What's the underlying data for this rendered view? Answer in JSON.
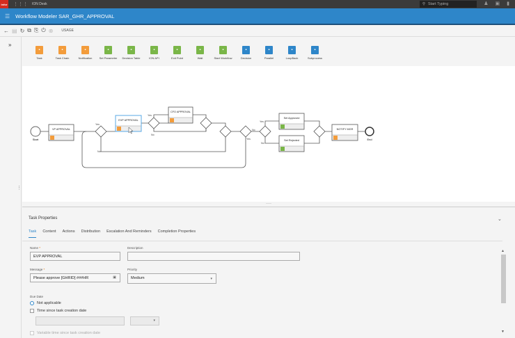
{
  "topbar": {
    "logo": "infor",
    "app_name": "ION Desk",
    "search_placeholder": "Start Typing"
  },
  "header": {
    "title": "Workflow Modeler SAR_GHR_APPROVAL"
  },
  "toolbar": {
    "usage_label": "USAGE"
  },
  "palette": [
    {
      "label": "Task",
      "color": "#f39c3b",
      "icon": "task-icon"
    },
    {
      "label": "Task Chain",
      "color": "#f39c3b",
      "icon": "task-chain-icon"
    },
    {
      "label": "Notification",
      "color": "#f39c3b",
      "icon": "notification-icon"
    },
    {
      "label": "Set Parameter",
      "color": "#7ab648",
      "icon": "set-parameter-icon"
    },
    {
      "label": "Decision Table",
      "color": "#7ab648",
      "icon": "decision-table-icon"
    },
    {
      "label": "ION API",
      "color": "#7ab648",
      "icon": "ion-api-icon"
    },
    {
      "label": "Exit Point",
      "color": "#7ab648",
      "icon": "exit-point-icon"
    },
    {
      "label": "Wait",
      "color": "#7ab648",
      "icon": "wait-icon"
    },
    {
      "label": "Start Workflow",
      "color": "#7ab648",
      "icon": "start-workflow-icon"
    },
    {
      "label": "Decision",
      "color": "#2e86c9",
      "icon": "decision-icon"
    },
    {
      "label": "Parallel",
      "color": "#2e86c9",
      "icon": "parallel-icon"
    },
    {
      "label": "LoopBack",
      "color": "#2e86c9",
      "icon": "loopback-icon"
    },
    {
      "label": "Subprocess",
      "color": "#2e86c9",
      "icon": "subprocess-icon"
    }
  ],
  "diagram": {
    "start": "Start",
    "end": "End",
    "nodes": {
      "vp": "VP APPROVAL",
      "evp": "EVP APPROVAL",
      "cfo": "CFO APPROVAL",
      "set_approved": "Set Approved",
      "set_rejected": "Set Rejected",
      "notify": "NOTIFY MGR"
    },
    "yes": "Yes",
    "no": "No"
  },
  "properties": {
    "title": "Task Properties",
    "tabs": [
      "Task",
      "Content",
      "Actions",
      "Distribution",
      "Escalation And Reminders",
      "Completion Properties"
    ],
    "active_tab": "Task",
    "name_label": "Name",
    "name_value": "EVP APPROVAL",
    "description_label": "Description",
    "description_value": "",
    "message_label": "Message",
    "message_value": "Please approve [GHRID] ###HR",
    "priority_label": "Priority",
    "priority_value": "Medium",
    "due_date_label": "Due Date",
    "due_options": [
      "Not applicable",
      "Time since task creation date",
      "Variable time since task creation date"
    ],
    "due_selected": "Not applicable"
  }
}
